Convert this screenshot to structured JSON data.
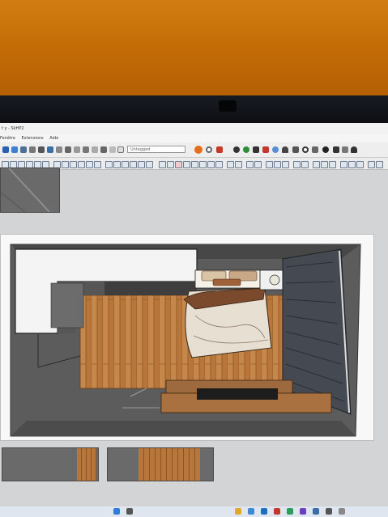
{
  "window": {
    "title": "t y - SkHP2"
  },
  "menu": {
    "items": [
      "Fenêtre",
      "Extensions",
      "Aide"
    ]
  },
  "toolbar": {
    "layer_value": "Untagged",
    "accent": "#e56e1a"
  },
  "colors": {
    "wall_background": "#c06a06",
    "screen_gray": "#d9dadc",
    "floor_wood": "#b8763a",
    "room_dark": "#5c5c5c",
    "bedding": "#e7dfd2",
    "curtain": "#454a52"
  },
  "icons": [
    "select-icon",
    "eraser-icon",
    "paint-icon",
    "line-icon",
    "arc-icon",
    "rectangle-icon",
    "push-pull-icon",
    "move-icon",
    "rotate-icon",
    "scale-icon",
    "tape-measure-icon",
    "text-icon",
    "orbit-icon",
    "pan-icon",
    "zoom-icon",
    "warehouse-icon",
    "extension-icon",
    "layout-icon",
    "user-icon"
  ]
}
